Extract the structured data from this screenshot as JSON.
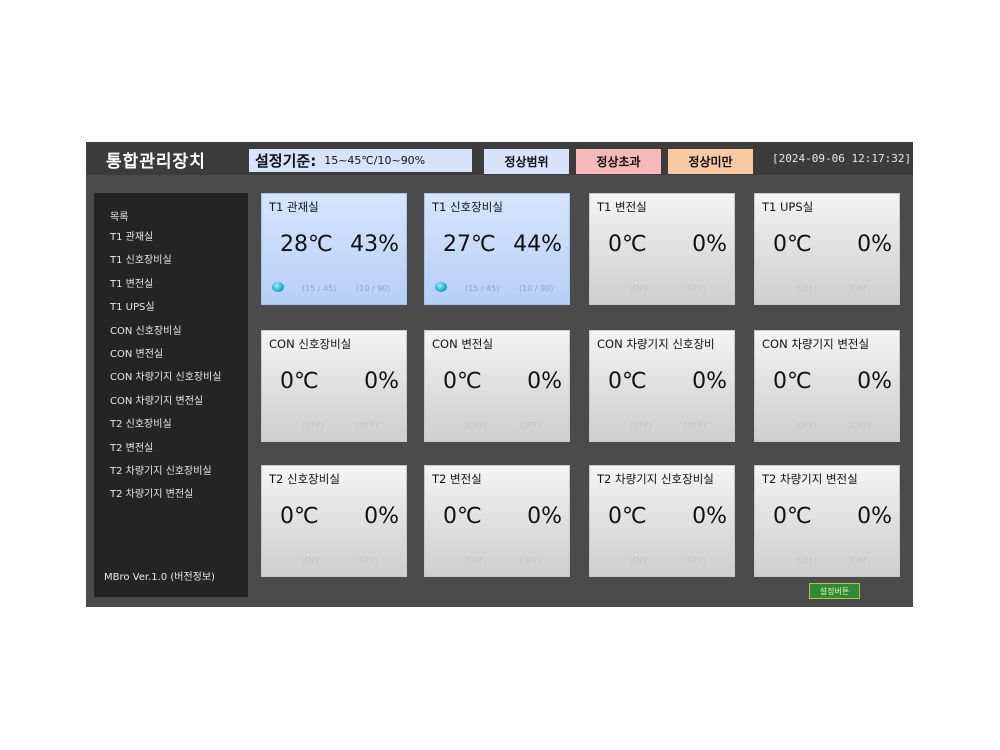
{
  "header": {
    "title": "통합관리장치",
    "criteria_label": "설정기준:",
    "criteria_value": "15~45℃/10~90%",
    "legend_normal": "정상범위",
    "legend_over": "정상초과",
    "legend_under": "정상미만",
    "datetime": "[2024-09-06 12:17:32]"
  },
  "colors": {
    "normal": "#d6e3fb",
    "over": "#f7b8b8",
    "under": "#f9c9a1"
  },
  "sidebar": {
    "title": "목록",
    "items": [
      {
        "label": "T1 관재실"
      },
      {
        "label": "T1 신호장비실"
      },
      {
        "label": "T1 변전실"
      },
      {
        "label": "T1 UPS실"
      },
      {
        "label": "CON 신호장비실"
      },
      {
        "label": "CON 변전실"
      },
      {
        "label": "CON 차량기지 신호장비실"
      },
      {
        "label": "CON 차량기지 변전실"
      },
      {
        "label": "T2 신호장비실"
      },
      {
        "label": "T2 변전실"
      },
      {
        "label": "T2 차량기지 신호장비실"
      },
      {
        "label": "T2 차량기지 변전실"
      }
    ],
    "version": "MBro Ver.1.0 (버전정보)"
  },
  "cards": [
    {
      "name": "T1 관재실",
      "temp": "28℃",
      "hum": "43%",
      "temp_range": "(15 / 45)",
      "hum_range": "(10 / 90)",
      "status": "normal"
    },
    {
      "name": "T1 신호장비실",
      "temp": "27℃",
      "hum": "44%",
      "temp_range": "(15 / 45)",
      "hum_range": "(10 / 90)",
      "status": "normal"
    },
    {
      "name": "T1 변전실",
      "temp": "0℃",
      "hum": "0%",
      "temp_range": "(OFF)",
      "hum_range": "(OFF)",
      "status": "off"
    },
    {
      "name": "T1 UPS실",
      "temp": "0℃",
      "hum": "0%",
      "temp_range": "(OFF)",
      "hum_range": "(OFF)",
      "status": "off"
    },
    {
      "name": "CON 신호장비실",
      "temp": "0℃",
      "hum": "0%",
      "temp_range": "(OFF)",
      "hum_range": "(OFF)",
      "status": "off"
    },
    {
      "name": "CON 변전실",
      "temp": "0℃",
      "hum": "0%",
      "temp_range": "(OFF)",
      "hum_range": "(OFF)",
      "status": "off"
    },
    {
      "name": "CON 차량기지 신호장비",
      "temp": "0℃",
      "hum": "0%",
      "temp_range": "(OFF)",
      "hum_range": "(OFF)",
      "status": "off"
    },
    {
      "name": "CON 차량기지 변전실",
      "temp": "0℃",
      "hum": "0%",
      "temp_range": "(OFF)",
      "hum_range": "(OFF)",
      "status": "off"
    },
    {
      "name": "T2 신호장비실",
      "temp": "0℃",
      "hum": "0%",
      "temp_range": "(OFF)",
      "hum_range": "(OFF)",
      "status": "off"
    },
    {
      "name": "T2 변전실",
      "temp": "0℃",
      "hum": "0%",
      "temp_range": "(OFF)",
      "hum_range": "(OFF)",
      "status": "off"
    },
    {
      "name": "T2 차량기지 신호장비실",
      "temp": "0℃",
      "hum": "0%",
      "temp_range": "(OFF)",
      "hum_range": "(OFF)",
      "status": "off"
    },
    {
      "name": "T2 차량기지 변전실",
      "temp": "0℃",
      "hum": "0%",
      "temp_range": "(OFF)",
      "hum_range": "(OFF)",
      "status": "off"
    }
  ],
  "settings_button": "설정버튼"
}
